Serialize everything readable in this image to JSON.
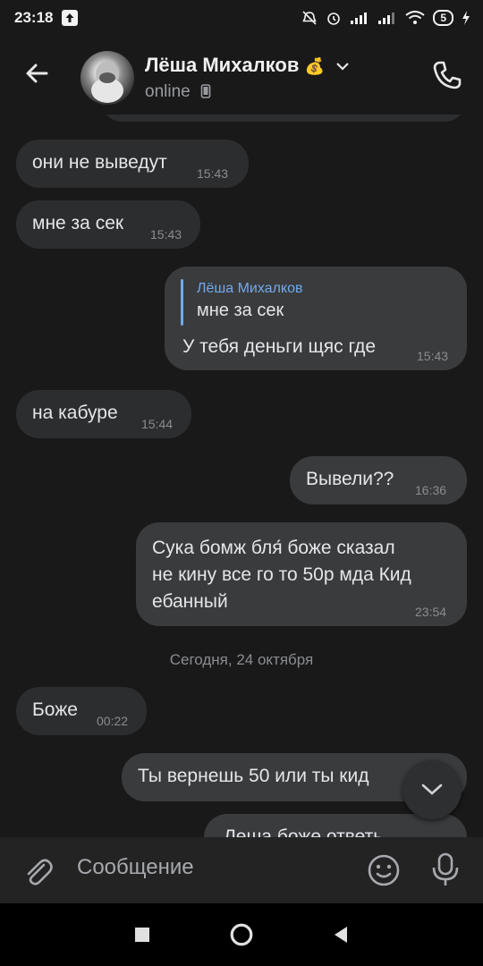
{
  "status_bar": {
    "time": "23:18",
    "battery": "5"
  },
  "header": {
    "name": "Лёша Михалков",
    "badge_emoji": "💰",
    "status": "online"
  },
  "messages": [
    {
      "id": "m1",
      "text": "они не выведут",
      "time": "15:43"
    },
    {
      "id": "m2",
      "text": "мне за сек",
      "time": "15:43"
    },
    {
      "id": "m3",
      "reply_author": "Лёша Михалков",
      "reply_text": "мне за сек",
      "text": "У тебя деньги щяс где",
      "time": "15:43"
    },
    {
      "id": "m4",
      "text": "на кабуре",
      "time": "15:44"
    },
    {
      "id": "m5",
      "text": "Вывели??",
      "time": "16:36"
    },
    {
      "id": "m6",
      "lines": [
        "Сука бомж бля́ боже сказал",
        "не кину все го то 50р мда Кид",
        "ебанный"
      ],
      "time": "23:54"
    },
    {
      "id": "m7",
      "text": "Боже",
      "time": "00:22"
    },
    {
      "id": "m8",
      "text": "Ты вернешь 50 или ты кид"
    },
    {
      "id": "m9",
      "text": "Леша боже ответь"
    }
  ],
  "date_separator": "Сегодня, 24 октября",
  "composer": {
    "placeholder": "Сообщение"
  },
  "colors": {
    "background": "#19191a",
    "bubble_in": "#2c2d2e",
    "bubble_out": "#3a3b3d",
    "reply_accent": "#71aaeb"
  }
}
